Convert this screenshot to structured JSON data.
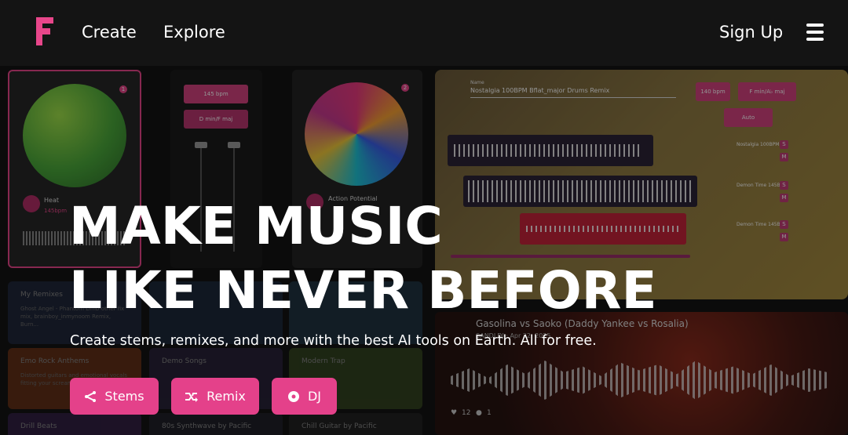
{
  "header": {
    "logo_letter": "F",
    "nav": {
      "create": "Create",
      "explore": "Explore"
    },
    "sign_up": "Sign Up"
  },
  "hero": {
    "title_line1": "MAKE MUSIC",
    "title_line2": "LIKE NEVER BEFORE",
    "subtitle": "Create stems, remixes, and more with the best AI tools on Earth. All for free.",
    "buttons": {
      "stems": "Stems",
      "remix": "Remix",
      "dj": "DJ"
    }
  },
  "background": {
    "deck_left": {
      "badge": "1",
      "title": "Heat",
      "sub": "145bpm"
    },
    "deck_right": {
      "badge": "2",
      "title": "Action Potential"
    },
    "mixer": {
      "bpm": "145 bpm",
      "key": "D min/F maj"
    },
    "editor": {
      "name_label": "Name",
      "name_value": "Nostalgia 100BPM Bflat_major Drums Remix",
      "bpm": "140 bpm",
      "key": "F min/A♭ maj",
      "auto": "Auto",
      "tracks": [
        "Nostalgia 100BPM B",
        "Demon Time 145BP",
        "Demon Time 145BP"
      ]
    },
    "tiles": [
      {
        "title": "My Remixes",
        "text": "Ghost Angel - Phantom Limb-other fix mix, brainboy_inmynoom Remix, Burn..."
      },
      {
        "title": "Emo Rock Anthems",
        "text": "Distorted guitars and emotional vocals fitting your screamo..."
      },
      {
        "title": "Demo Songs",
        "text": ""
      },
      {
        "title": "Modern Trap",
        "text": ""
      },
      {
        "title": "Drill Beats",
        "text": ""
      },
      {
        "title": "80s Synthwave by Pacific",
        "text": ""
      },
      {
        "title": "Chill Guitar by Pacific",
        "text": ""
      }
    ],
    "feature": {
      "title": "Gasolina vs Saoko (Daddy Yankee vs Rosalia)",
      "sub": "SANDLDJ · Apr 22, 2025",
      "likes": "12",
      "comments": "1"
    }
  },
  "colors": {
    "accent": "#e4418a",
    "background": "#141414"
  }
}
